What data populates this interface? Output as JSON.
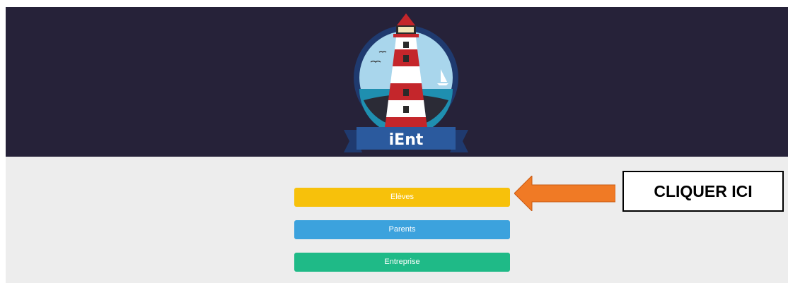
{
  "header": {
    "logo_text": "iEnt",
    "background": "#262239"
  },
  "buttons": [
    {
      "label": "Elèves",
      "color": "#f7c10b"
    },
    {
      "label": "Parents",
      "color": "#3ca2dd"
    },
    {
      "label": "Entreprise",
      "color": "#1fba87"
    }
  ],
  "annotation": {
    "callout_text": "CLIQUER ICI",
    "arrow_color": "#f07a25"
  }
}
